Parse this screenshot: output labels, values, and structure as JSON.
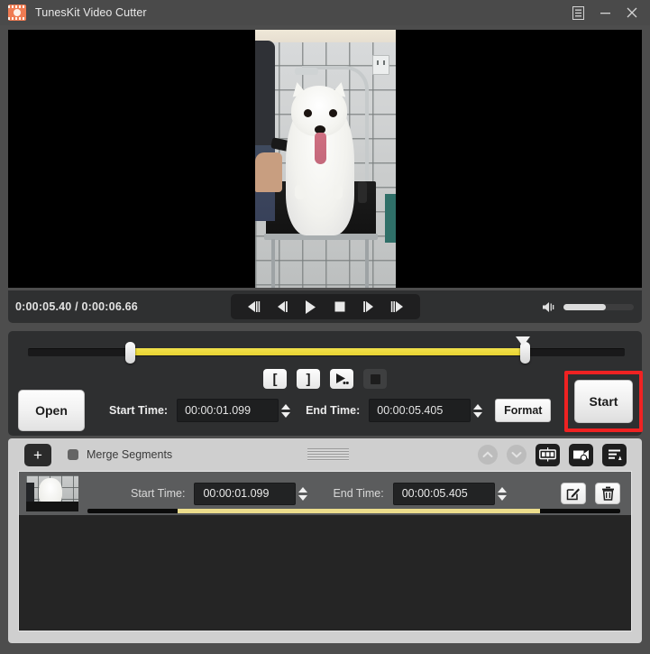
{
  "window": {
    "title": "TunesKit Video Cutter",
    "logo_icon": "film-strip-icon",
    "menu_icon": "menu-icon",
    "minimize_icon": "minimize-icon",
    "close_icon": "close-icon"
  },
  "player": {
    "current_time": "0:00:05.40",
    "total_time": "0:00:06.66",
    "time_display": "0:00:05.40 / 0:00:06.66",
    "transport": [
      {
        "name": "step-back-fast-button",
        "icon": "skip-backward-icon"
      },
      {
        "name": "step-back-button",
        "icon": "previous-frame-icon"
      },
      {
        "name": "play-button",
        "icon": "play-icon"
      },
      {
        "name": "stop-button",
        "icon": "stop-icon"
      },
      {
        "name": "step-forward-button",
        "icon": "next-frame-icon"
      },
      {
        "name": "step-forward-fast-button",
        "icon": "skip-forward-icon"
      }
    ],
    "volume": {
      "icon": "volume-icon",
      "level_percent": 60
    }
  },
  "trim": {
    "selection_start_percent": 17,
    "selection_end_percent": 83,
    "playhead_percent": 82,
    "mark_buttons": [
      {
        "name": "mark-in-button",
        "label": "[",
        "icon": "bracket-left-icon",
        "enabled": true
      },
      {
        "name": "mark-out-button",
        "label": "]",
        "icon": "bracket-right-icon",
        "enabled": true
      },
      {
        "name": "preview-segment-button",
        "label": "",
        "icon": "play-preview-icon",
        "enabled": true
      },
      {
        "name": "stop-preview-button",
        "label": "",
        "icon": "stop-square-icon",
        "enabled": false
      }
    ],
    "open_label": "Open",
    "start_time_label": "Start Time:",
    "start_time_value": "00:00:01.099",
    "end_time_label": "End Time:",
    "end_time_value": "00:00:05.405",
    "format_label": "Format",
    "start_label": "Start",
    "start_highlight_color": "#ef2222"
  },
  "segments_panel": {
    "add_label": "+",
    "merge_label": "Merge Segments",
    "merge_checked": false,
    "grip_icon": "drag-handle-icon",
    "tools": [
      {
        "name": "move-up-button",
        "icon": "chevron-up-icon",
        "enabled": false
      },
      {
        "name": "move-down-button",
        "icon": "chevron-down-icon",
        "enabled": false
      },
      {
        "name": "effects-button",
        "icon": "effects-grid-icon",
        "enabled": true
      },
      {
        "name": "snapshot-button",
        "icon": "video-snapshot-icon",
        "enabled": true
      },
      {
        "name": "list-options-button",
        "icon": "list-sort-icon",
        "enabled": true
      }
    ],
    "rows": [
      {
        "thumbnail": "dog-thumbnail",
        "start_time_label": "Start Time:",
        "start_time_value": "00:00:01.099",
        "end_time_label": "End Time:",
        "end_time_value": "00:00:05.405",
        "edit_icon": "edit-pencil-icon",
        "delete_icon": "trash-icon",
        "progress_start_percent": 17,
        "progress_end_percent": 85
      }
    ]
  },
  "colors": {
    "accent_yellow": "#ecdd8c",
    "trim_yellow": "#eedc3c",
    "highlight_red": "#ef2222",
    "panel_dark": "#2e2f30",
    "panel_light": "#cfcfcf"
  }
}
